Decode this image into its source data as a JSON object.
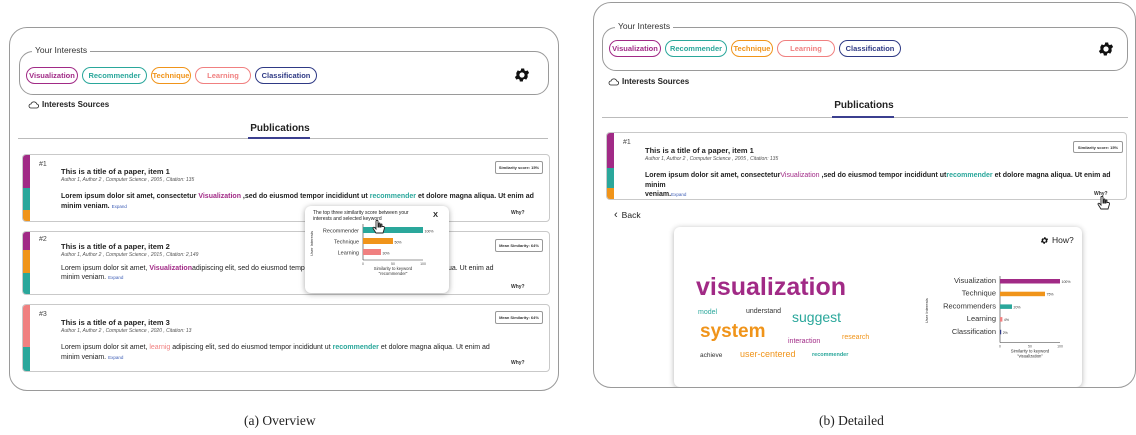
{
  "colors": {
    "visualization": "#a12a86",
    "recommender": "#2aa79b",
    "technique": "#f0941a",
    "learning": "#f08080",
    "classification": "#2f3a85",
    "recommender_text": "#1f9e8f"
  },
  "interests": {
    "legend": "Your Interests",
    "chips": [
      "Visualization",
      "Recommender",
      "Technique",
      "Learning",
      "Classification"
    ],
    "sources_label": "Interests Sources"
  },
  "publications": {
    "header": "Publications"
  },
  "overview": {
    "items": [
      {
        "num": "#1",
        "title": "This is a title of a paper, item 1",
        "meta": "Author 1, Author 2 , Computer Science , 2005 , Citation: 135",
        "body_a": "Lorem ipsum dolor sit amet, consectetur ",
        "kw1": "Visualization",
        "body_b": " ,sed do eiusmod tempor incididunt ut ",
        "kw2": "recommender",
        "body_c": " et dolore magna aliqua. Ut enim ad minim veniam.",
        "expand": "Expand",
        "score": "Similarity score: 15%",
        "why": "Why?"
      },
      {
        "num": "#2",
        "title": "This is a title of a paper, item 2",
        "meta": "Author 1, Author 2 , Computer Science , 2015 , Citation: 2,149",
        "body_a": "Lorem ipsum dolor sit amet, ",
        "kw1": "Visualization",
        "body_b": "adipiscing elit, sed do eiusmod tempor",
        "body_c": "ua. Ut enim ad",
        "body_d": "minim veniam.",
        "expand": "Expand",
        "score": "Mean Similarity: 64%",
        "why": "Why?"
      },
      {
        "num": "#3",
        "title": "This is a title of a paper, item 3",
        "meta": "Author 1, Author 2 , Computer Science , 2020 , Citation: 13",
        "body_a": "Lorem ipsum dolor sit amet, ",
        "kw1": "learnig",
        "body_b": " adipiscing elit, sed do eiusmod tempor incididunt ut ",
        "kw2": "recommender",
        "body_c": " et dolore magna aliqua. Ut enim ad",
        "body_d": "minim veniam.",
        "expand": "Expand",
        "score": "Mean Similarity: 64%",
        "why": "Why?"
      }
    ],
    "popup": {
      "heading": "The top three similarity score between your interests and selected keyword",
      "close": "X",
      "ylabel": "User Interests",
      "xlabel": "Similarity to keyword \"recommender\""
    }
  },
  "detailed": {
    "item": {
      "num": "#1",
      "title": "This is a title of a paper, item 1",
      "meta": "Author 1, Author 2 , Computer Science , 2005 , Citation: 135",
      "body_a": "Lorem ipsum dolor sit amet, consectetur",
      "kw1": "Visualization",
      "body_b": " ,sed do eiusmod tempor incididunt ut",
      "kw2": "recommender",
      "body_c": " et dolore magna aliqua. Ut enim ad minim",
      "body_d": "veniam.",
      "expand": "Expand",
      "score": "Similarity score: 15%",
      "why": "Why?"
    },
    "back": "Back",
    "how": "How?",
    "cloud": [
      "visualization",
      "model",
      "understand",
      "suggest",
      "system",
      "research",
      "interaction",
      "achieve",
      "user-centered",
      "recommender"
    ],
    "bar_ylabel": "User Interests",
    "bar_xlabel": "Similarity to keyword \"visualization\""
  },
  "chart_data": [
    {
      "type": "bar",
      "orientation": "horizontal",
      "categories": [
        "Recommender",
        "Technique",
        "Learning"
      ],
      "values": [
        100,
        50,
        30
      ],
      "labels": [
        "100%",
        "50%",
        "30%"
      ],
      "xlim": [
        0,
        100
      ],
      "ticks": [
        "0",
        "50",
        "100"
      ],
      "ylabel": "User Interests",
      "xlabel": "Similarity to keyword \"recommender\""
    },
    {
      "type": "bar",
      "orientation": "horizontal",
      "categories": [
        "Visualization",
        "Technique",
        "Recommenders",
        "Learning",
        "Classification"
      ],
      "values": [
        100,
        75,
        20,
        4,
        2
      ],
      "labels": [
        "100%",
        "75%",
        "20%",
        "4%",
        "2%"
      ],
      "xlim": [
        0,
        100
      ],
      "ticks": [
        "0",
        "50",
        "100"
      ],
      "ylabel": "User Interests",
      "xlabel": "Similarity to keyword \"visualization\""
    }
  ],
  "captions": {
    "a": "(a) Overview",
    "b": "(b) Detailed"
  }
}
